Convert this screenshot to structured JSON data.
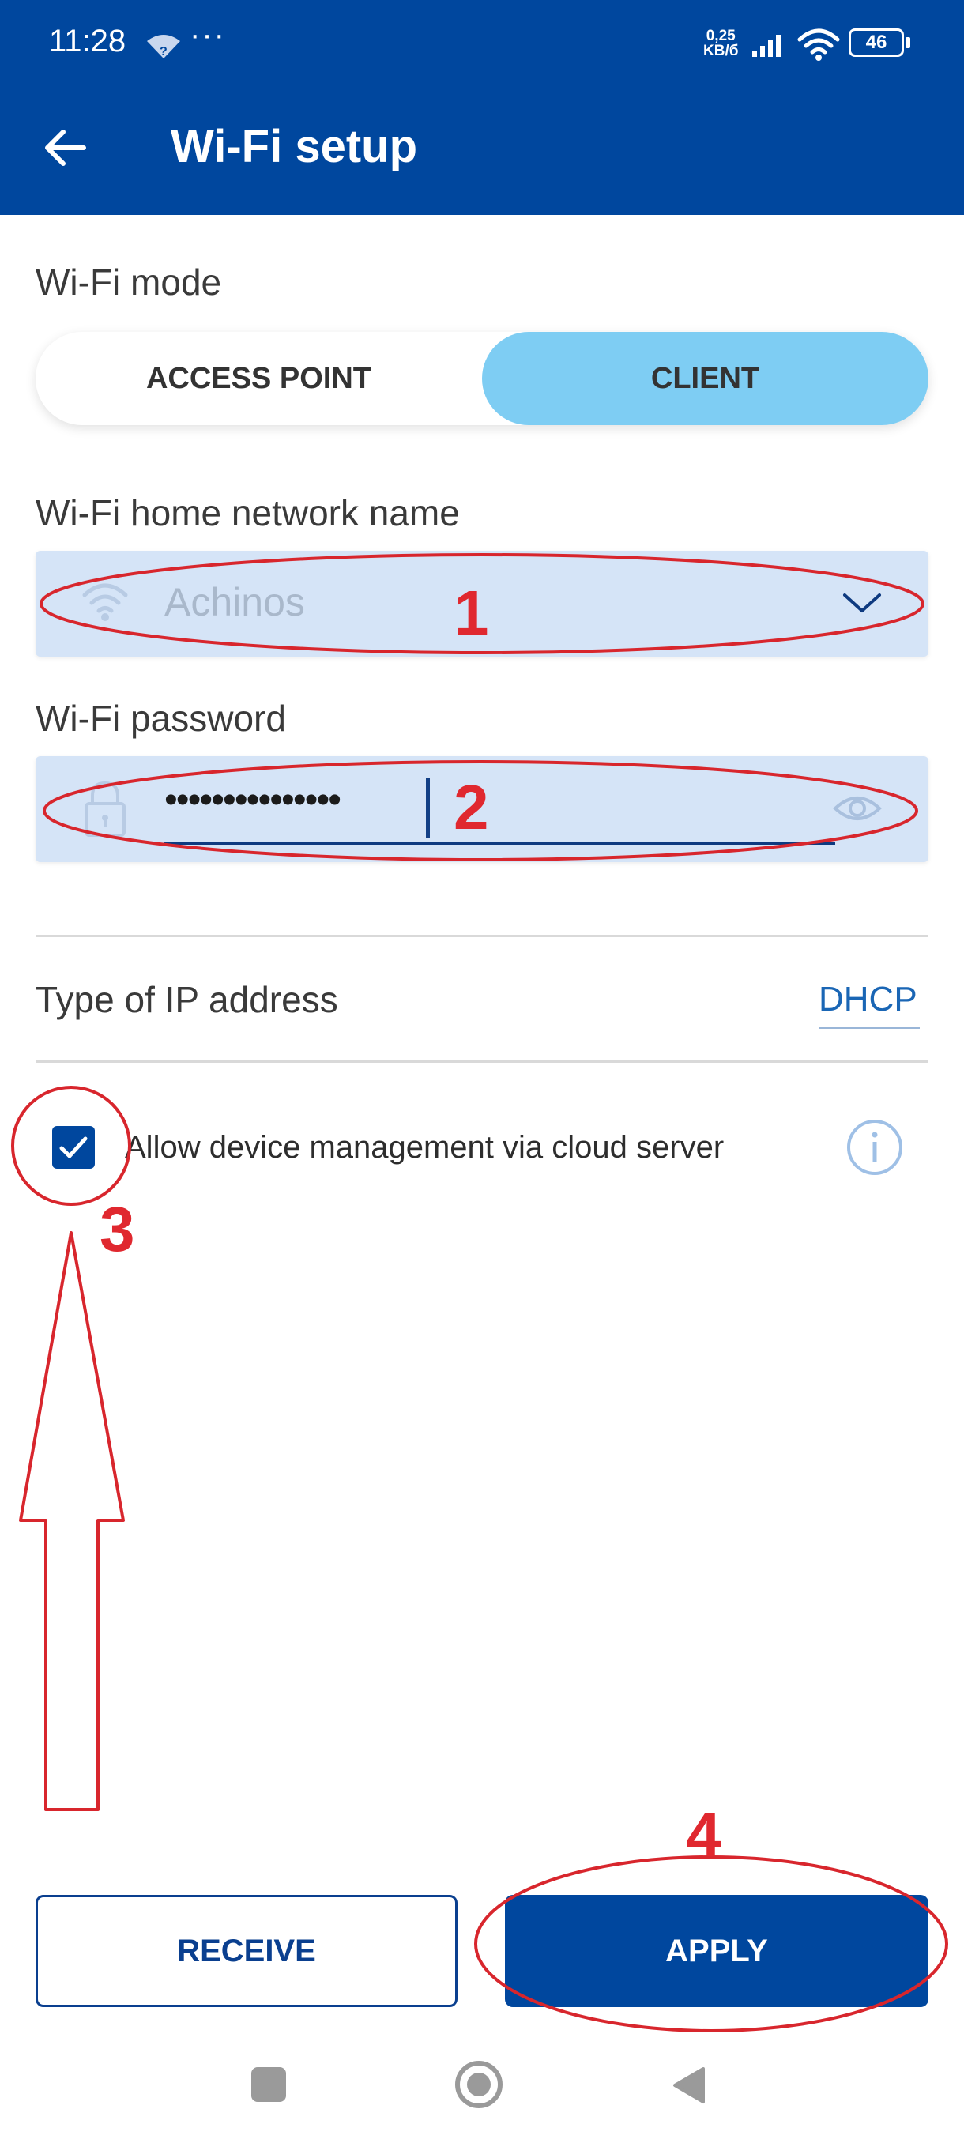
{
  "status_bar": {
    "time": "11:28",
    "more": "···",
    "speed_top": "0,25",
    "speed_bottom": "KB/б",
    "battery": "46",
    "icons": [
      "wifi-question-icon",
      "signal-icon",
      "wifi-icon",
      "battery-icon"
    ]
  },
  "app_bar": {
    "back_icon": "arrow-back-icon",
    "title": "Wi-Fi setup"
  },
  "wifi_mode": {
    "label": "Wi-Fi mode",
    "options": [
      "ACCESS POINT",
      "CLIENT"
    ],
    "selected": "CLIENT"
  },
  "network": {
    "label": "Wi-Fi home network name",
    "value": "Achinos",
    "icon": "wifi-icon",
    "dropdown_icon": "chevron-down-icon"
  },
  "password": {
    "label": "Wi-Fi password",
    "value": "•••••••••••••••",
    "lock_icon": "lock-icon",
    "visibility_icon": "eye-icon"
  },
  "ip_type": {
    "label": "Type of IP address",
    "value": "DHCP"
  },
  "cloud": {
    "checked": true,
    "label": "Allow device management via cloud server",
    "info_icon": "info-icon"
  },
  "buttons": {
    "receive": "RECEIVE",
    "apply": "APPLY"
  },
  "annotations": [
    "1",
    "2",
    "3",
    "4"
  ],
  "colors": {
    "primary": "#00479e",
    "selected_segment": "#7ecdf3",
    "field_bg": "#d5e4f7",
    "annotation": "#e0282f"
  }
}
